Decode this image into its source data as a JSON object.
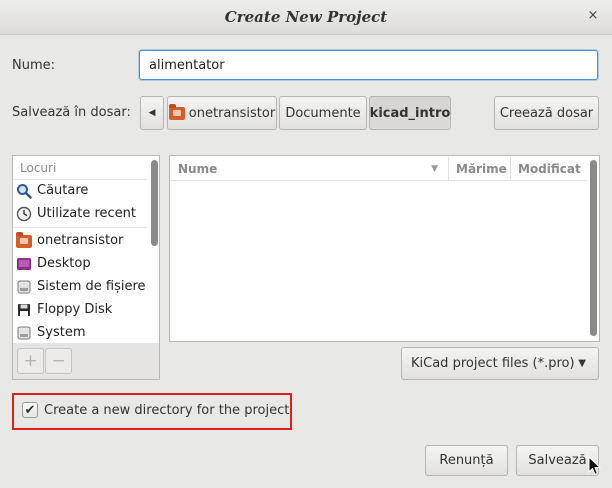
{
  "window": {
    "title": "Create New Project",
    "close_glyph": "×"
  },
  "name_row": {
    "label": "Nume:",
    "value": "alimentator"
  },
  "folder_row": {
    "label": "Salvează în dosar:",
    "back_glyph": "◀",
    "path": [
      "onetransistor",
      "Documente",
      "kicad_intro"
    ],
    "create_folder_label": "Creează dosar"
  },
  "places": {
    "header": "Locuri",
    "items": [
      {
        "label": "Căutare",
        "icon": "search-icon"
      },
      {
        "label": "Utilizate recent",
        "icon": "recent-icon"
      },
      {
        "label": "onetransistor",
        "icon": "home-folder-icon"
      },
      {
        "label": "Desktop",
        "icon": "desktop-icon"
      },
      {
        "label": "Sistem de fișiere",
        "icon": "drive-icon"
      },
      {
        "label": "Floppy Disk",
        "icon": "floppy-icon"
      },
      {
        "label": "System",
        "icon": "drive-icon"
      }
    ],
    "add_glyph": "+",
    "remove_glyph": "−"
  },
  "files": {
    "columns": [
      "Nume",
      "Mărime",
      "Modificat"
    ],
    "sort_glyph": "▼"
  },
  "filter": {
    "selected": "KiCad project files (*.pro)",
    "arrow_glyph": "▼"
  },
  "options": {
    "new_dir_checked": true,
    "new_dir_label": "Create a new directory for the project",
    "check_glyph": "✔"
  },
  "actions": {
    "cancel_label": "Renunță",
    "save_label": "Salvează"
  },
  "colors": {
    "focus": "#4a90d9",
    "highlight": "#e01f1f",
    "folder": "#d45e2a"
  }
}
